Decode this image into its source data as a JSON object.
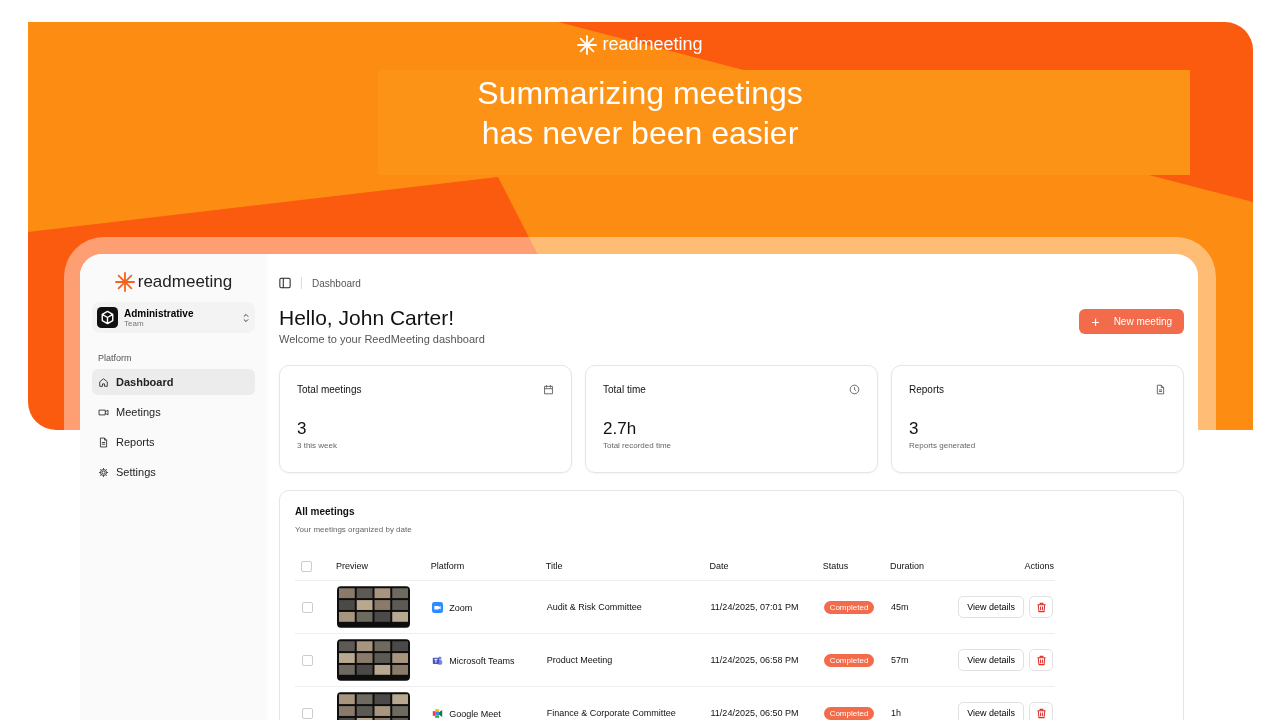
{
  "banner": {
    "brand": "readmeeting",
    "headline": [
      "Summarizing meetings",
      "has never been easier"
    ]
  },
  "sidebar": {
    "brand": "readmeeting",
    "team": {
      "name": "Administrative",
      "plan": "Team"
    },
    "section": "Platform",
    "items": [
      {
        "label": "Dashboard",
        "selected": true
      },
      {
        "label": "Meetings",
        "selected": false
      },
      {
        "label": "Reports",
        "selected": false
      },
      {
        "label": "Settings",
        "selected": false
      }
    ]
  },
  "breadcrumb": "Dashboard",
  "greeting": {
    "title": "Hello, John Carter!",
    "subtitle": "Welcome to your ReedMeeting dashboard"
  },
  "new_meeting_button": {
    "icon": "+",
    "label": "New meeting"
  },
  "stats": [
    {
      "label": "Total meetings",
      "value": "3",
      "note": "3 this week"
    },
    {
      "label": "Total time",
      "value": "2.7h",
      "note": "Total recorded time"
    },
    {
      "label": "Reports",
      "value": "3",
      "note": "Reports generated"
    }
  ],
  "table": {
    "title": "All meetings",
    "subtitle": "Your meetings organized by date",
    "all_checked": false,
    "columns": [
      "Preview",
      "Platform",
      "Title",
      "Date",
      "Status",
      "Duration",
      "Actions"
    ],
    "rows": [
      {
        "checked": false,
        "platform": {
          "kind": "zoom",
          "name": "Zoom"
        },
        "title": "Audit & Risk Committee",
        "date": "11/24/2025, 07:01 PM",
        "status": "Completed",
        "duration": "45m",
        "action": "View details"
      },
      {
        "checked": false,
        "platform": {
          "kind": "teams",
          "name": "Microsoft Teams"
        },
        "title": "Product Meeting",
        "date": "11/24/2025, 06:58 PM",
        "status": "Completed",
        "duration": "57m",
        "action": "View details"
      },
      {
        "checked": false,
        "platform": {
          "kind": "meet",
          "name": "Google Meet"
        },
        "title": "Finance & Corporate Committee",
        "date": "11/24/2025, 06:50 PM",
        "status": "Completed",
        "duration": "1h",
        "action": "View details"
      }
    ]
  }
}
